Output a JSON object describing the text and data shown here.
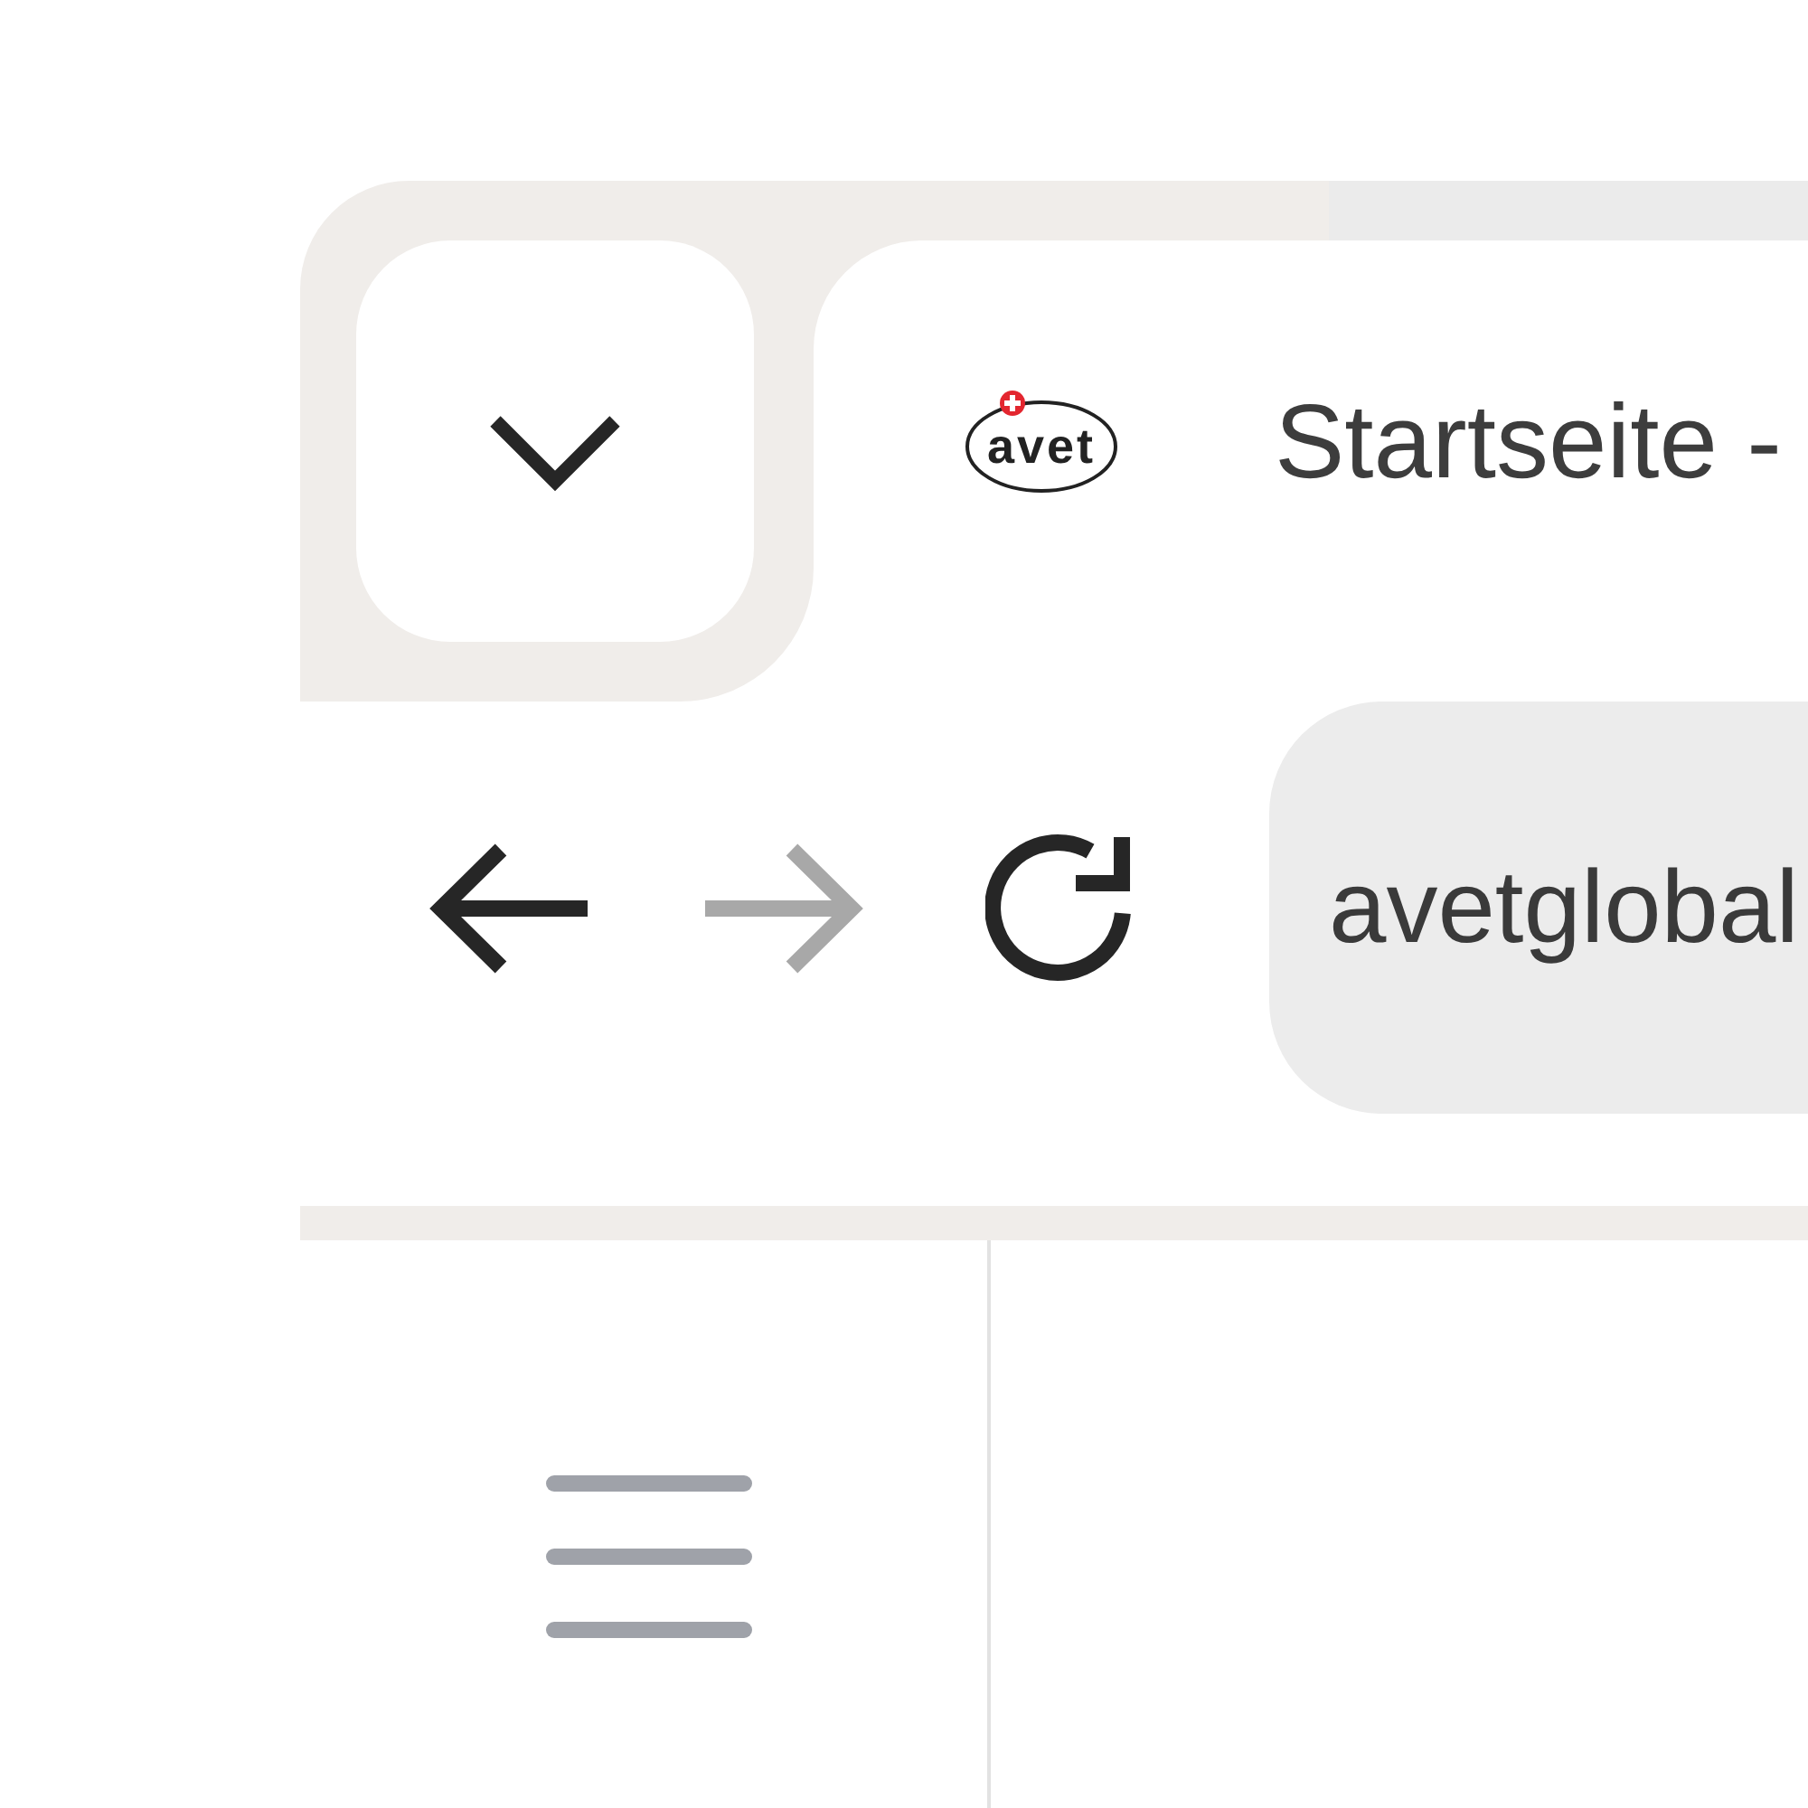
{
  "tab_strip": {
    "tabs": [
      {
        "title": "Startseite -",
        "favicon_text": "avet",
        "selected": true
      }
    ]
  },
  "toolbar": {
    "nav_buttons": [
      {
        "kind": "back",
        "disabled": false
      },
      {
        "kind": "forward",
        "disabled": true
      },
      {
        "kind": "reload",
        "disabled": false
      }
    ],
    "address_bar": {
      "value": "avetglobal"
    }
  }
}
